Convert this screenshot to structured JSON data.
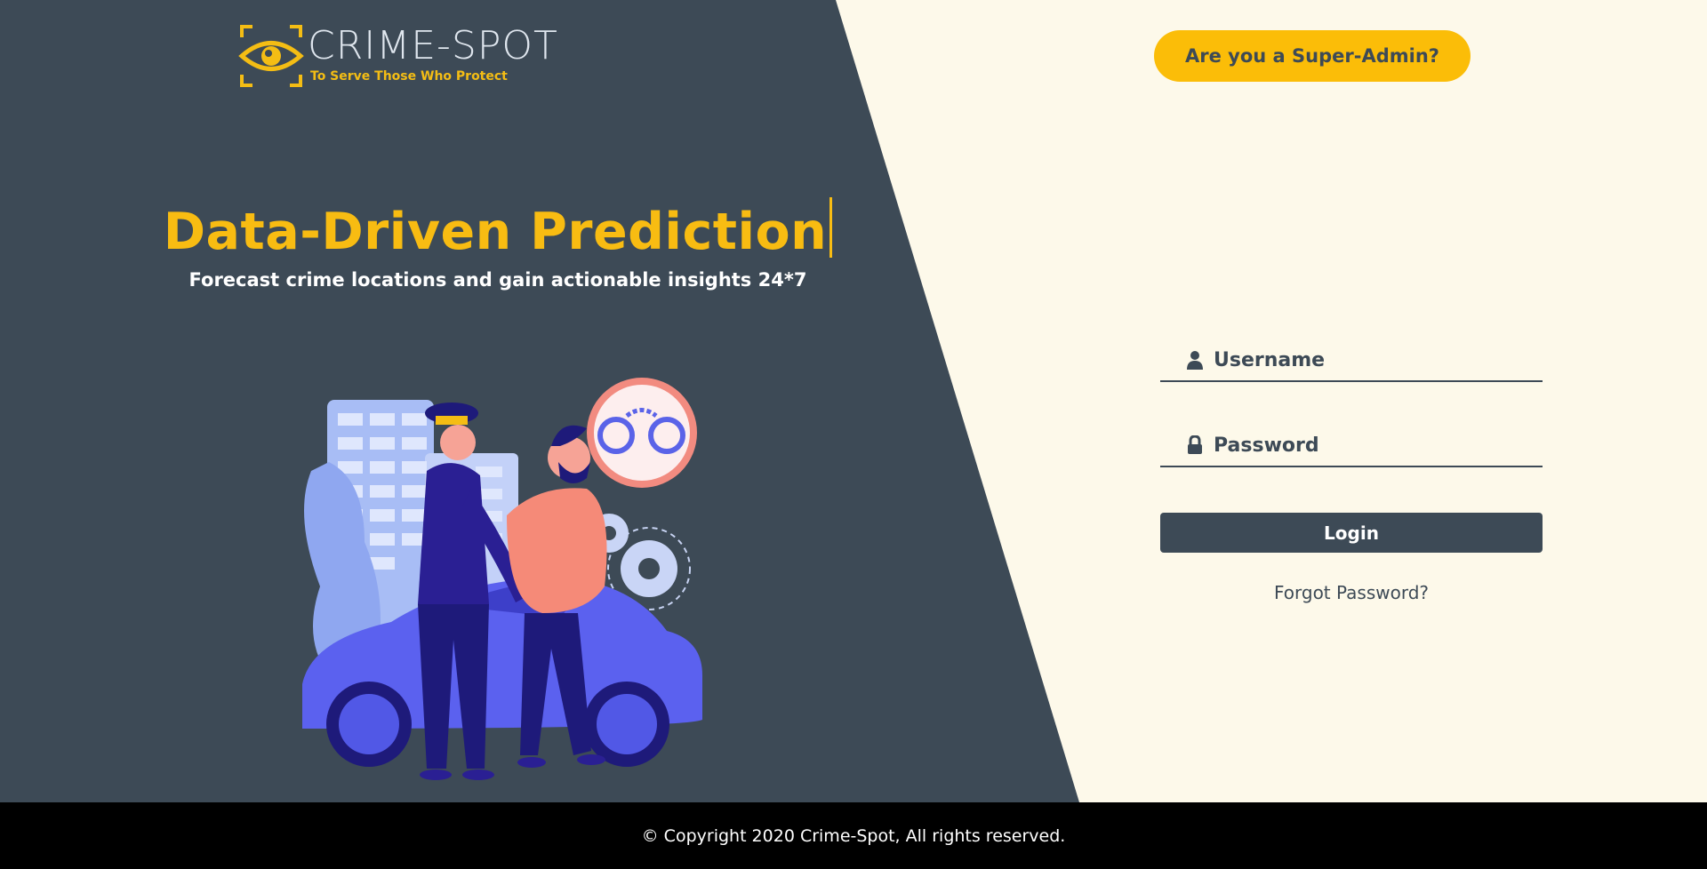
{
  "brand": {
    "name": "CRIME-SPOT",
    "tagline": "To Serve Those Who Protect",
    "logo_icon": "eye-icon"
  },
  "hero": {
    "headline": "Data-Driven Prediction",
    "subheadline": "Forecast crime locations and gain actionable insights 24*7",
    "illustration": "police-arrest-illustration"
  },
  "header": {
    "super_admin_label": "Are you a Super-Admin?"
  },
  "login_form": {
    "username_placeholder": "Username",
    "username_value": "",
    "username_icon": "user-icon",
    "password_placeholder": "Password",
    "password_value": "",
    "password_icon": "lock-icon",
    "login_label": "Login",
    "forgot_password_label": "Forgot Password?"
  },
  "footer": {
    "copyright": "© Copyright 2020 Crime-Spot, All rights reserved."
  },
  "colors": {
    "dark_panel": "#3d4a56",
    "accent_yellow": "#fbbd08",
    "light_background": "#fdf9ea",
    "footer_background": "#000000"
  }
}
